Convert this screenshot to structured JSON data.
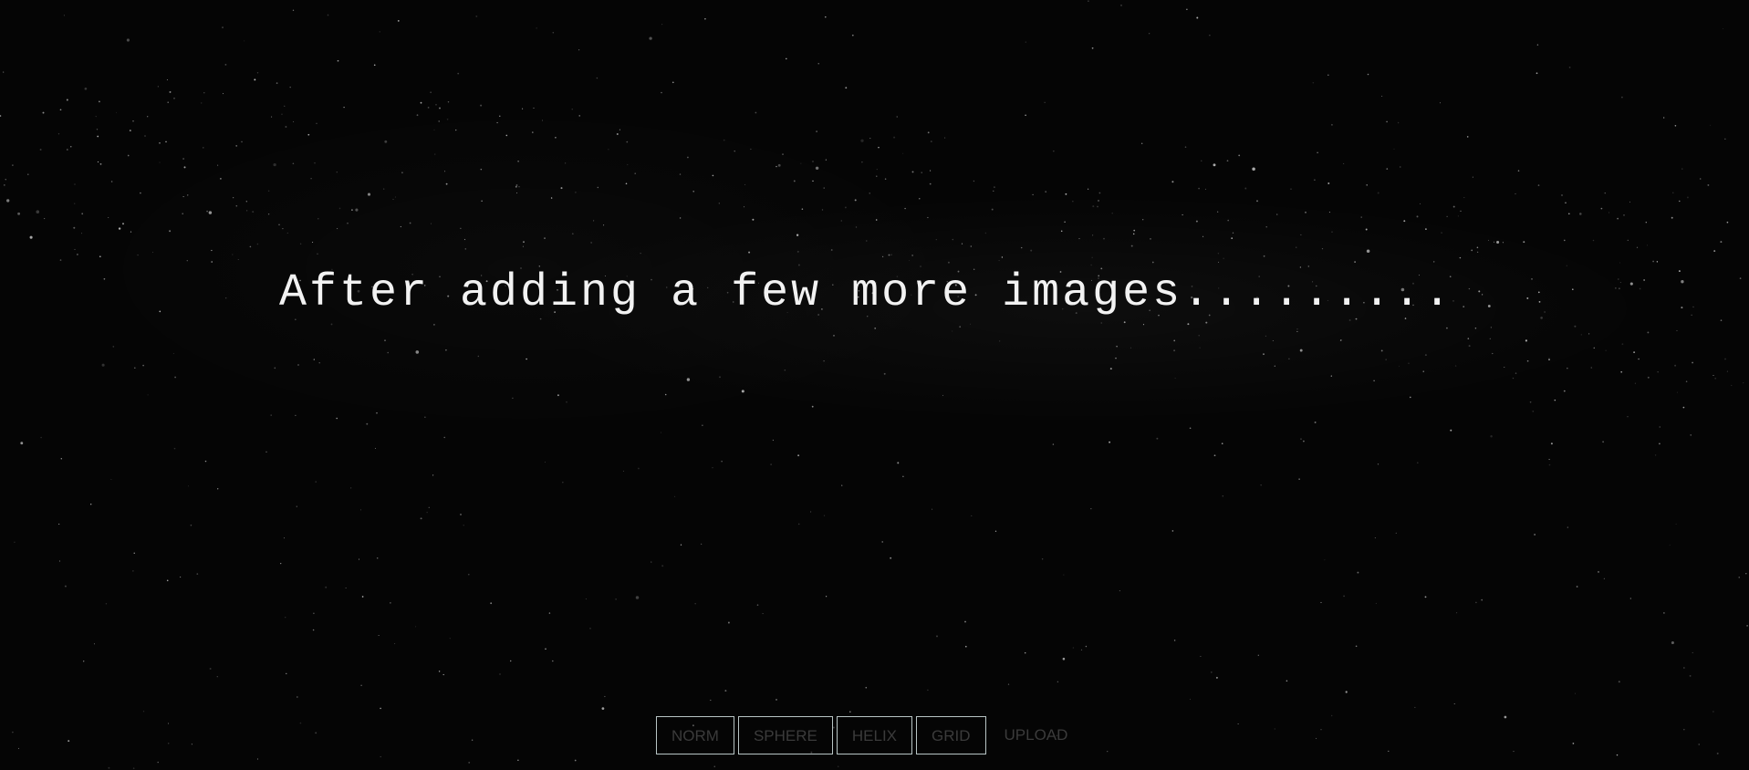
{
  "headline": "After adding a few more images.........",
  "menu": {
    "buttons": [
      {
        "label": "NORM"
      },
      {
        "label": "SPHERE"
      },
      {
        "label": "HELIX"
      },
      {
        "label": "GRID"
      }
    ],
    "upload_label": "UPLOAD"
  },
  "colors": {
    "background": "#050505",
    "headline": "#f2f2f2",
    "button_border": "#b8c5c5",
    "button_text": "#3b3b3b",
    "stars": "#ffffff"
  },
  "icons": [
    "starfield-background"
  ]
}
